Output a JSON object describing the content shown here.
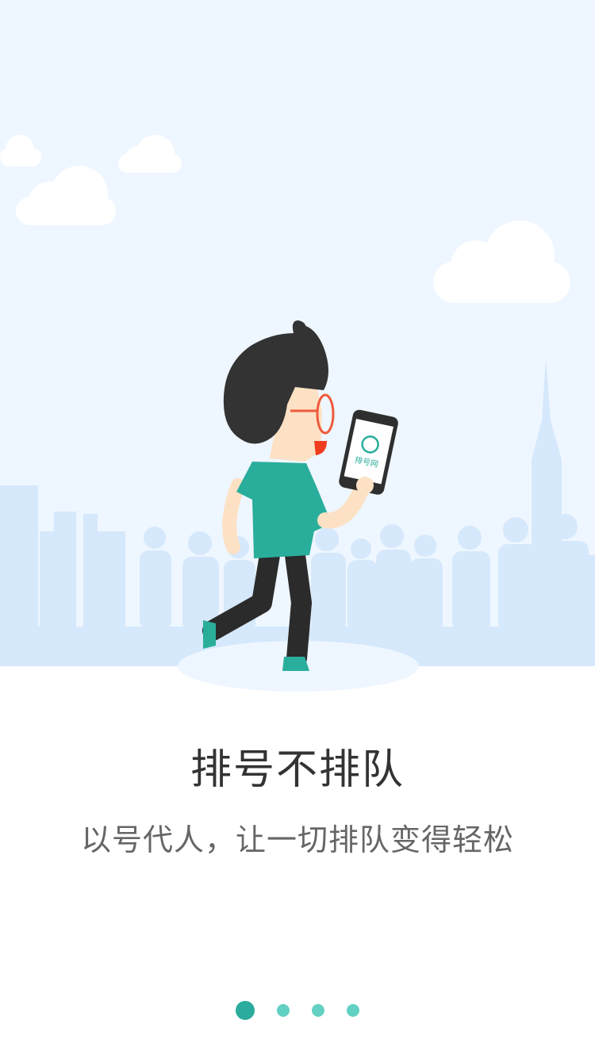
{
  "app": {
    "logo_text": "排号网"
  },
  "onboarding": {
    "title": "排号不排队",
    "subtitle": "以号代人，让一切排队变得轻松",
    "page_count": 4,
    "active_page": 1
  },
  "illustration": {
    "subject": "man-with-phone",
    "colors": {
      "sky": "#eef6ff",
      "cloud": "#ffffff",
      "skyline": "#d6e8fb",
      "shirt": "#2aae9c",
      "hair": "#333333",
      "skin": "#fde1c4",
      "glasses": "#ef5a3c",
      "pants": "#2b2b2b",
      "shoes": "#2aae9c",
      "phone": "#2f2f2f"
    }
  },
  "colors": {
    "accent": "#2aab9d",
    "dot_inactive": "#62d0c3",
    "title": "#333333",
    "subtitle": "#666666"
  }
}
